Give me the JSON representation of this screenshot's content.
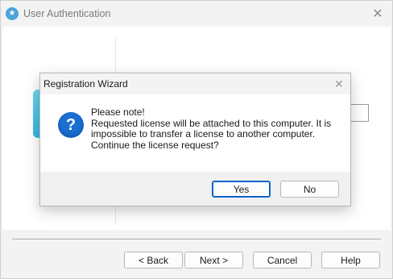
{
  "main_window": {
    "title": "User Authentication",
    "app_icon": "star-icon",
    "close_icon": "close-icon",
    "close_glyph": "✕"
  },
  "footer": {
    "back_label": "< Back",
    "next_label": "Next >",
    "cancel_label": "Cancel",
    "help_label": "Help"
  },
  "dialog": {
    "title": "Registration Wizard",
    "close_icon": "close-icon",
    "close_glyph": "✕",
    "icon": "question-icon",
    "icon_glyph": "?",
    "message_lines": [
      "Please note!",
      "Requested license will be attached to this computer. It is",
      "impossible to transfer a license to another computer.",
      "Continue the license request?"
    ],
    "yes_label": "Yes",
    "no_label": "No"
  },
  "colors": {
    "accent": "#0a64c8",
    "question_icon": "#1a6fd1",
    "app_icon": "#4aa3d9",
    "side_graphic": "#31b6e0"
  }
}
